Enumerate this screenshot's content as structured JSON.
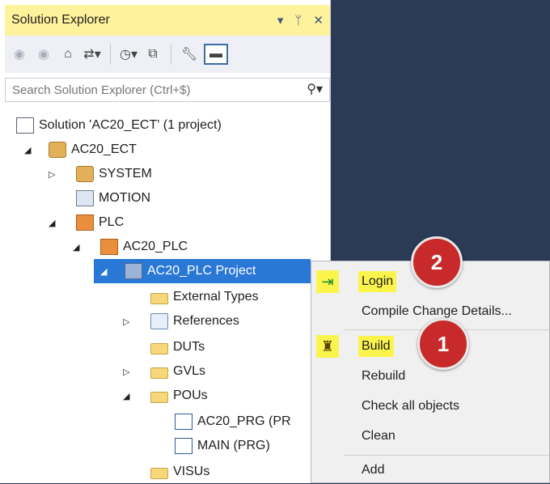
{
  "panel": {
    "title": "Solution Explorer",
    "title_icons": [
      "dropdown-icon",
      "pin-icon",
      "close-icon"
    ]
  },
  "toolbar": {
    "buttons": [
      "back-icon",
      "forward-icon",
      "home-icon",
      "sync-icon",
      "history-icon",
      "collapse-icon",
      "properties-icon",
      "preview-icon"
    ]
  },
  "search": {
    "placeholder": "Search Solution Explorer (Ctrl+$)",
    "icon": "search-icon"
  },
  "tree": {
    "solution": "Solution 'AC20_ECT' (1 project)",
    "project": "AC20_ECT",
    "system": "SYSTEM",
    "motion": "MOTION",
    "plc": "PLC",
    "plc_item": "AC20_PLC",
    "plc_project": "AC20_PLC Project",
    "external_types": "External Types",
    "references": "References",
    "duts": "DUTs",
    "gvls": "GVLs",
    "pous": "POUs",
    "prg_item": "AC20_PRG (PR",
    "main_item": "MAIN (PRG)",
    "visus": "VISUs"
  },
  "context_menu": {
    "login": "Login",
    "compile_change": "Compile Change Details...",
    "build": "Build",
    "rebuild": "Rebuild",
    "check_all": "Check all objects",
    "clean": "Clean",
    "add": "Add"
  },
  "badges": {
    "first": "1",
    "second": "2"
  },
  "colors": {
    "title_highlight": "#fff29d",
    "selection": "#2a78d6",
    "menu_highlight": "#fbf44d",
    "badge": "#c8292b",
    "background": "#2b3a55"
  }
}
